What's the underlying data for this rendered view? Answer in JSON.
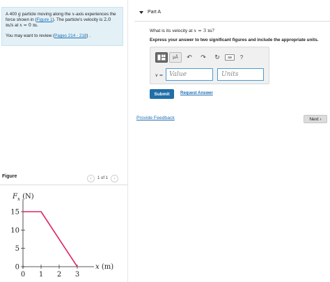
{
  "problem": {
    "line1_pre": "A 400 ",
    "line1_unit": "g",
    "line1_mid": " particle moving along the ",
    "line1_var": "x",
    "line1_post": "-axis experiences the force shown in (",
    "figure_link": "Figure 1",
    "line1_end": "). The particle's velocity is ",
    "velocity": "2.0 m/s",
    "at": " at ",
    "x_var": "x",
    "x_eq": " = 0 m.",
    "review_pre": "You may want to review (",
    "review_link": "Pages 214 - 218",
    "review_post": ") ."
  },
  "figure": {
    "label": "Figure",
    "pager_text": "1 of 1",
    "prev_icon": "chevron-left",
    "next_icon": "chevron-right"
  },
  "chart_data": {
    "type": "line",
    "x": [
      0,
      1,
      3
    ],
    "y": [
      15,
      15,
      0
    ],
    "ylabel_var": "F",
    "ylabel_sub": "x",
    "ylabel_unit": " (N)",
    "xlabel_var": "x",
    "xlabel_unit": " (m)",
    "xticks": [
      "0",
      "1",
      "2",
      "3"
    ],
    "yticks": [
      "0",
      "5",
      "10",
      "15"
    ],
    "xlim": [
      0,
      3
    ],
    "ylim": [
      0,
      15
    ],
    "color": "#e0245e",
    "grid": false
  },
  "part": {
    "title": "Part A",
    "question_pre": "What is its velocity at ",
    "question_var": "x",
    "question_post": " = 3 m?",
    "instruction": "Express your answer to two significant figures and include the appropriate units.",
    "value_label": "v =",
    "value_placeholder": "Value",
    "units_placeholder": "Units",
    "toolbar": {
      "mu_label": "μÅ",
      "undo_glyph": "↶",
      "redo_glyph": "↷",
      "reset_glyph": "↻",
      "keyboard_label": "⌨",
      "help_glyph": "?"
    },
    "submit_label": "Submit",
    "request_label": "Request Answer"
  },
  "footer": {
    "feedback_label": "Provide Feedback",
    "next_label": "Next ›"
  }
}
